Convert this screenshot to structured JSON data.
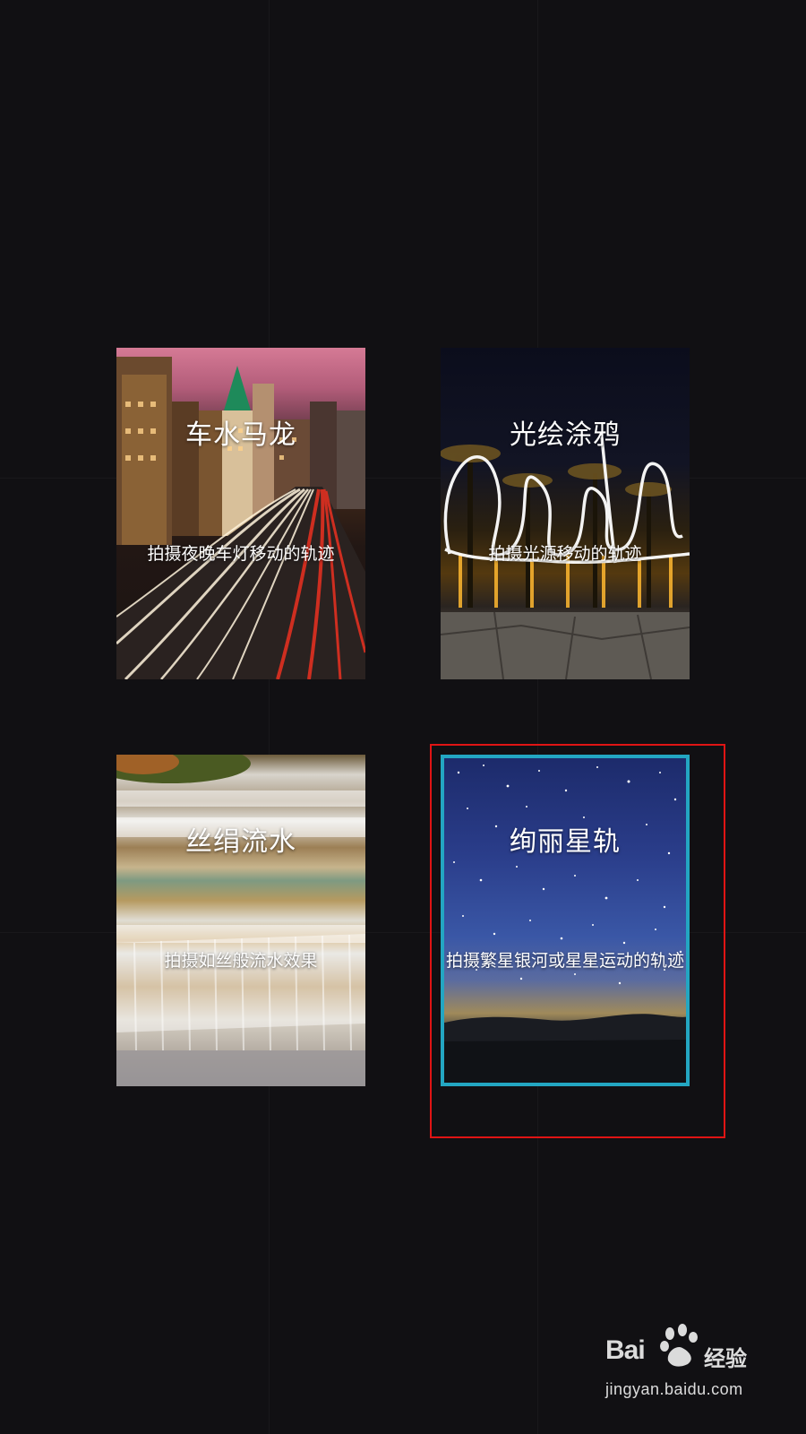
{
  "modes": [
    {
      "title": "车水马龙",
      "description": "拍摄夜晚车灯移动的轨迹",
      "selected": false
    },
    {
      "title": "光绘涂鸦",
      "description": "拍摄光源移动的轨迹",
      "selected": false
    },
    {
      "title": "丝绢流水",
      "description": "拍摄如丝般流水效果",
      "selected": false
    },
    {
      "title": "绚丽星轨",
      "description": "拍摄繁星银河或星星运动的轨迹",
      "selected": true
    }
  ],
  "watermark": {
    "brand": "Bai",
    "brand_suffix": "经验",
    "url": "jingyan.baidu.com"
  },
  "colors": {
    "background": "#111013",
    "selected_border": "#23a6c2",
    "annotation_box": "#e01414"
  }
}
